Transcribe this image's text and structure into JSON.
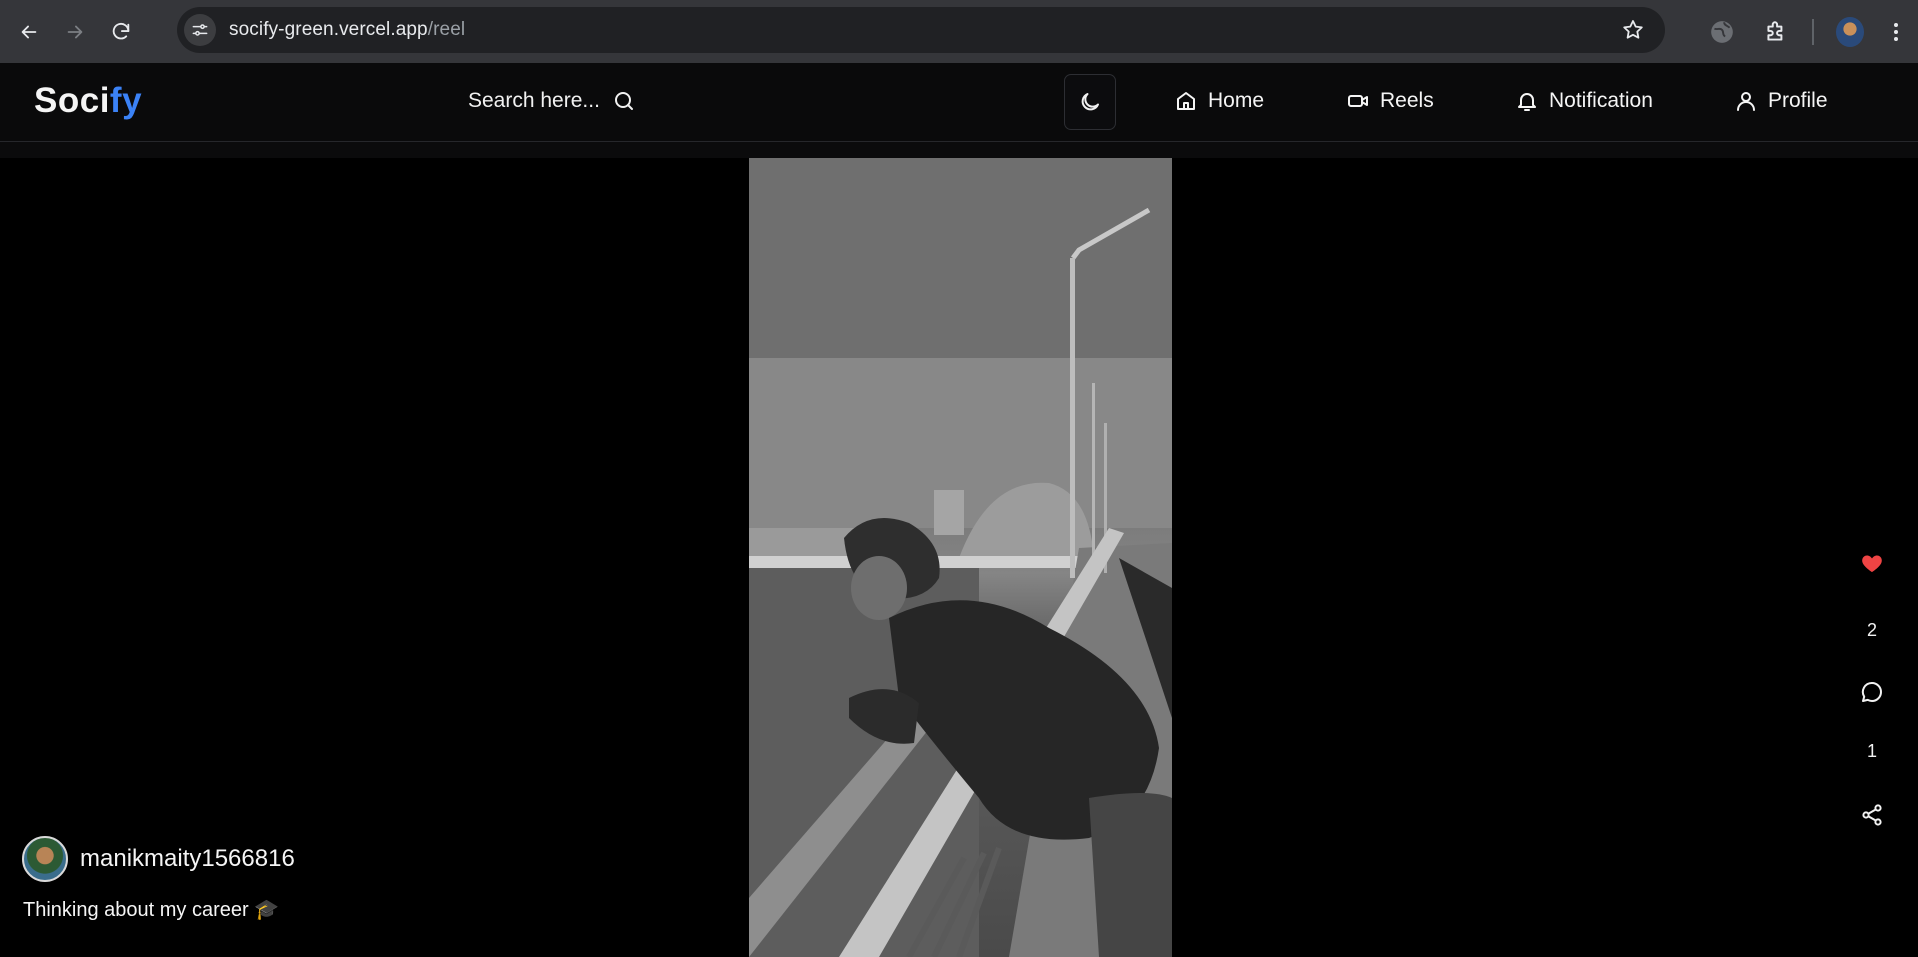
{
  "browser": {
    "url_host": "socify-green.vercel.app",
    "url_path": "/reel"
  },
  "app": {
    "logo_part1": "Soci",
    "logo_part2": "fy",
    "brand_color": "#3b82f6",
    "search_placeholder": "Search here...",
    "nav": [
      {
        "label": "Home",
        "icon": "home-icon"
      },
      {
        "label": "Reels",
        "icon": "video-icon"
      },
      {
        "label": "Notification",
        "icon": "bell-icon"
      },
      {
        "label": "Profile",
        "icon": "user-icon"
      }
    ]
  },
  "reel": {
    "author": "manikmaity1566816",
    "caption": "Thinking about my career 🎓",
    "likes": "2",
    "comments": "1",
    "liked": true,
    "like_color": "#ef4444"
  }
}
